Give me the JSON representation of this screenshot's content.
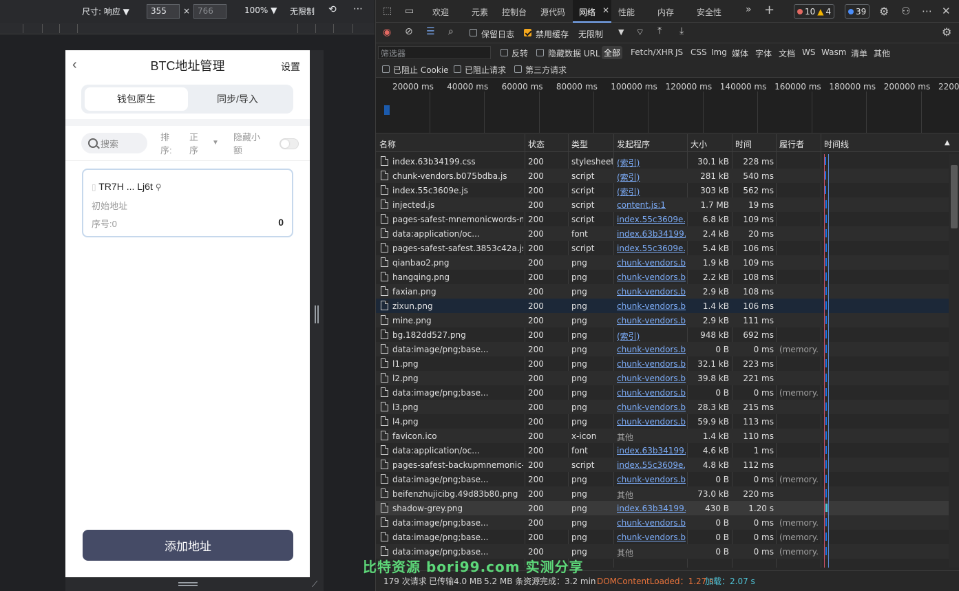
{
  "device_toolbar": {
    "size_label": "尺寸: 响应",
    "width": "355",
    "height_placeholder": "766",
    "times": "×",
    "zoom": "100%",
    "throttle": "无限制"
  },
  "phone": {
    "title": "BTC地址管理",
    "settings": "设置",
    "tabs": [
      "钱包原生",
      "同步/导入"
    ],
    "search_placeholder": "搜索",
    "sort_label_1": "排",
    "sort_label_2": "序:",
    "sort_value_1": "正",
    "sort_value_2": "序",
    "hide_label_1": "隐藏小",
    "hide_label_2": "额",
    "card": {
      "address": "TR7H ... Lj6t",
      "subtitle": "初始地址",
      "seq": "序号:0",
      "balance": "0"
    },
    "add_button": "添加地址"
  },
  "devtools": {
    "tabs": [
      "欢迎",
      "元素",
      "控制台",
      "源代码",
      "网络",
      "性能",
      "内存",
      "安全性"
    ],
    "active_tab": "网络",
    "errors": "10",
    "warnings": "4",
    "info": "39",
    "toolbar": {
      "preserve_log": "保留日志",
      "disable_cache": "禁用缓存",
      "throttle": "无限制"
    },
    "filter": {
      "placeholder": "筛选器",
      "invert": "反转",
      "hide_data_url": "隐藏数据 URL",
      "types": [
        "全部",
        "Fetch/XHR",
        "JS",
        "CSS",
        "Img",
        "媒体",
        "字体",
        "文档",
        "WS",
        "Wasm",
        "清单",
        "其他"
      ],
      "blocked_cookie": "已阻止 Cookie",
      "blocked_requests": "已阻止请求",
      "third_party": "第三方请求"
    },
    "overview_ticks": [
      "20000 ms",
      "40000 ms",
      "60000 ms",
      "80000 ms",
      "100000 ms",
      "120000 ms",
      "140000 ms",
      "160000 ms",
      "180000 ms",
      "200000 ms",
      "22000"
    ],
    "columns": [
      "名称",
      "状态",
      "类型",
      "发起程序",
      "大小",
      "时间",
      "履行者",
      "时间线"
    ],
    "rows": [
      {
        "name": "index.63b34199.css",
        "status": "200",
        "type": "stylesheet",
        "initiator": "(索引)",
        "size": "30.1 kB",
        "time": "228 ms",
        "fulfilled": ""
      },
      {
        "name": "chunk-vendors.b075bdba.js",
        "status": "200",
        "type": "script",
        "initiator": "(索引)",
        "size": "281 kB",
        "time": "540 ms",
        "fulfilled": ""
      },
      {
        "name": "index.55c3609e.js",
        "status": "200",
        "type": "script",
        "initiator": "(索引)",
        "size": "303 kB",
        "time": "562 ms",
        "fulfilled": ""
      },
      {
        "name": "injected.js",
        "status": "200",
        "type": "script",
        "initiator": "content.js:1",
        "size": "1.7 MB",
        "time": "19 ms",
        "fulfilled": ""
      },
      {
        "name": "pages-safest-mnemonicwords-m...",
        "status": "200",
        "type": "script",
        "initiator": "index.55c3609e.j...",
        "size": "6.8 kB",
        "time": "109 ms",
        "fulfilled": ""
      },
      {
        "name": "data:application/oc...",
        "status": "200",
        "type": "font",
        "initiator": "index.63b34199....",
        "size": "2.4 kB",
        "time": "20 ms",
        "fulfilled": ""
      },
      {
        "name": "pages-safest-safest.3853c42a.js",
        "status": "200",
        "type": "script",
        "initiator": "index.55c3609e.j...",
        "size": "5.4 kB",
        "time": "106 ms",
        "fulfilled": ""
      },
      {
        "name": "qianbao2.png",
        "status": "200",
        "type": "png",
        "initiator": "chunk-vendors.b...",
        "size": "1.9 kB",
        "time": "109 ms",
        "fulfilled": ""
      },
      {
        "name": "hangqing.png",
        "status": "200",
        "type": "png",
        "initiator": "chunk-vendors.b...",
        "size": "2.2 kB",
        "time": "108 ms",
        "fulfilled": ""
      },
      {
        "name": "faxian.png",
        "status": "200",
        "type": "png",
        "initiator": "chunk-vendors.b...",
        "size": "2.9 kB",
        "time": "108 ms",
        "fulfilled": ""
      },
      {
        "name": "zixun.png",
        "status": "200",
        "type": "png",
        "initiator": "chunk-vendors.b...",
        "size": "1.4 kB",
        "time": "106 ms",
        "fulfilled": ""
      },
      {
        "name": "mine.png",
        "status": "200",
        "type": "png",
        "initiator": "chunk-vendors.b...",
        "size": "2.9 kB",
        "time": "111 ms",
        "fulfilled": ""
      },
      {
        "name": "bg.182dd527.png",
        "status": "200",
        "type": "png",
        "initiator": "(索引)",
        "size": "948 kB",
        "time": "692 ms",
        "fulfilled": ""
      },
      {
        "name": "data:image/png;base...",
        "status": "200",
        "type": "png",
        "initiator": "chunk-vendors.b...",
        "size": "0 B",
        "time": "0 ms",
        "fulfilled": "(memory..."
      },
      {
        "name": "l1.png",
        "status": "200",
        "type": "png",
        "initiator": "chunk-vendors.b...",
        "size": "32.1 kB",
        "time": "223 ms",
        "fulfilled": ""
      },
      {
        "name": "l2.png",
        "status": "200",
        "type": "png",
        "initiator": "chunk-vendors.b...",
        "size": "39.8 kB",
        "time": "221 ms",
        "fulfilled": ""
      },
      {
        "name": "data:image/png;base...",
        "status": "200",
        "type": "png",
        "initiator": "chunk-vendors.b...",
        "size": "0 B",
        "time": "0 ms",
        "fulfilled": "(memory..."
      },
      {
        "name": "l3.png",
        "status": "200",
        "type": "png",
        "initiator": "chunk-vendors.b...",
        "size": "28.3 kB",
        "time": "215 ms",
        "fulfilled": ""
      },
      {
        "name": "l4.png",
        "status": "200",
        "type": "png",
        "initiator": "chunk-vendors.b...",
        "size": "59.9 kB",
        "time": "113 ms",
        "fulfilled": ""
      },
      {
        "name": "favicon.ico",
        "status": "200",
        "type": "x-icon",
        "initiator": "其他",
        "size": "1.4 kB",
        "time": "110 ms",
        "fulfilled": ""
      },
      {
        "name": "data:application/oc...",
        "status": "200",
        "type": "font",
        "initiator": "index.63b34199....",
        "size": "4.6 kB",
        "time": "1 ms",
        "fulfilled": ""
      },
      {
        "name": "pages-safest-backupmnemonic-b...",
        "status": "200",
        "type": "script",
        "initiator": "index.55c3609e.j...",
        "size": "4.8 kB",
        "time": "112 ms",
        "fulfilled": ""
      },
      {
        "name": "data:image/png;base...",
        "status": "200",
        "type": "png",
        "initiator": "chunk-vendors.b...",
        "size": "0 B",
        "time": "0 ms",
        "fulfilled": "(memory..."
      },
      {
        "name": "beifenzhujicibg.49d83b80.png",
        "status": "200",
        "type": "png",
        "initiator": "其他",
        "size": "73.0 kB",
        "time": "220 ms",
        "fulfilled": ""
      },
      {
        "name": "shadow-grey.png",
        "status": "200",
        "type": "png",
        "initiator": "index.63b34199....",
        "size": "430 B",
        "time": "1.20 s",
        "fulfilled": ""
      },
      {
        "name": "data:image/png;base...",
        "status": "200",
        "type": "png",
        "initiator": "chunk-vendors.b...",
        "size": "0 B",
        "time": "0 ms",
        "fulfilled": "(memory..."
      },
      {
        "name": "data:image/png;base...",
        "status": "200",
        "type": "png",
        "initiator": "chunk-vendors.b...",
        "size": "0 B",
        "time": "0 ms",
        "fulfilled": "(memory..."
      },
      {
        "name": "data:image/png;base...",
        "status": "200",
        "type": "png",
        "initiator": "其他",
        "size": "0 B",
        "time": "0 ms",
        "fulfilled": "(memory..."
      }
    ],
    "status_bar": {
      "requests": "179 次请求",
      "transferred": "已传输4.0 MB",
      "resources": "5.2 MB 条资源",
      "finish": "完成：3.2 min",
      "dcl_label": "DOMContentLoaded：",
      "dcl_value": "1.27 s",
      "load_label": "加载：",
      "load_value": "2.07 s"
    }
  },
  "watermark": "比特资源 bori99.com 实测分享",
  "colors": {
    "accent_blue": "#7cacf8",
    "button": "#454b66",
    "checkbox_on": "#f4a71d",
    "dcl": "#e8733b",
    "load": "#4fc3d6",
    "watermark": "#5dd879"
  }
}
